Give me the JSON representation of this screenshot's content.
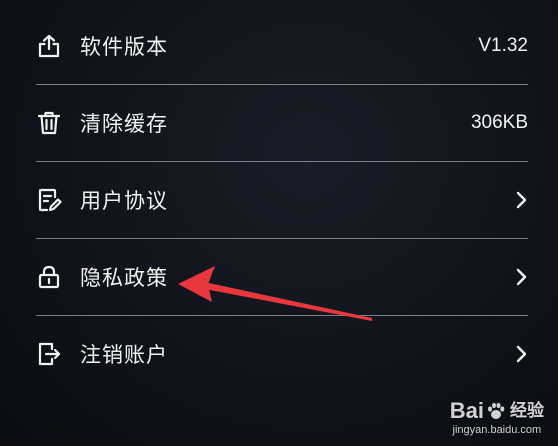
{
  "settings": {
    "items": [
      {
        "icon": "share-upload-icon",
        "label": "软件版本",
        "value": "V1.32"
      },
      {
        "icon": "trash-icon",
        "label": "清除缓存",
        "value": "306KB"
      },
      {
        "icon": "document-edit-icon",
        "label": "用户协议",
        "value": ""
      },
      {
        "icon": "lock-icon",
        "label": "隐私政策",
        "value": ""
      },
      {
        "icon": "logout-icon",
        "label": "注销账户",
        "value": ""
      }
    ]
  },
  "annotation": {
    "arrow_color": "#e8383d"
  },
  "watermark": {
    "brand_left": "Bai",
    "brand_right": "经验",
    "site": "jingyan.baidu.com"
  }
}
